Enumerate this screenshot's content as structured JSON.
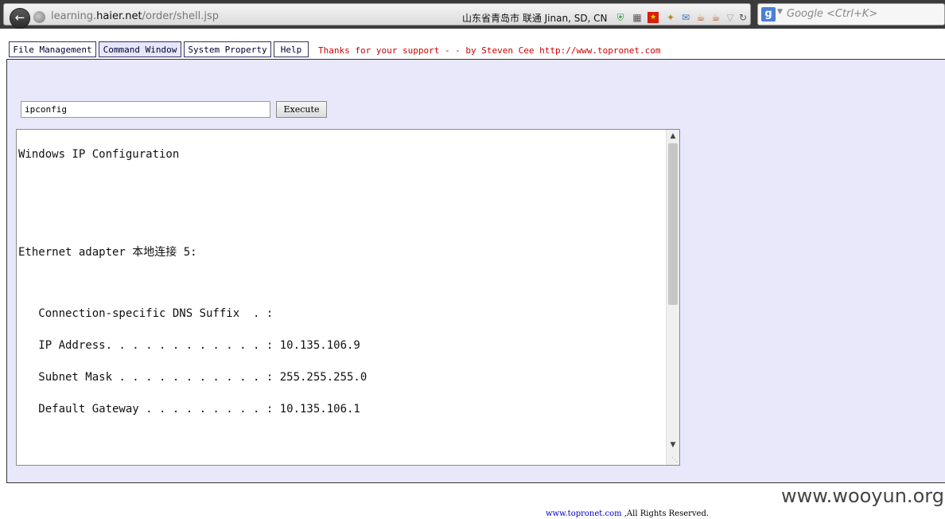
{
  "browser": {
    "url_prefix": "learning.",
    "url_domain": "haier.net",
    "url_path": "/order/shell.jsp",
    "location": "山东省青岛市 联通   Jinan, SD, CN",
    "search_placeholder": "Google <Ctrl+K>",
    "search_engine": "g"
  },
  "menu": {
    "items": [
      {
        "label": "File Management"
      },
      {
        "label": "Command Window",
        "active": true
      },
      {
        "label": "System Property"
      },
      {
        "label": "Help"
      }
    ],
    "thanks": "Thanks for your support - - by Steven Cee http://www.topronet.com"
  },
  "command": {
    "input_value": "ipconfig",
    "execute_label": "Execute"
  },
  "output": {
    "lines": [
      "Windows IP Configuration",
      "Ethernet adapter 本地连接 5:",
      "   Connection-specific DNS Suffix  . :",
      "   IP Address. . . . . . . . . . . . : 10.135.106.9",
      "   Subnet Mask . . . . . . . . . . . : 255.255.255.0",
      "   Default Gateway . . . . . . . . . : 10.135.106.1"
    ]
  },
  "watermark": "www.wooyun.org",
  "footer": {
    "link": "www.topronet.com",
    "text": " ,All Rights Reserved."
  }
}
